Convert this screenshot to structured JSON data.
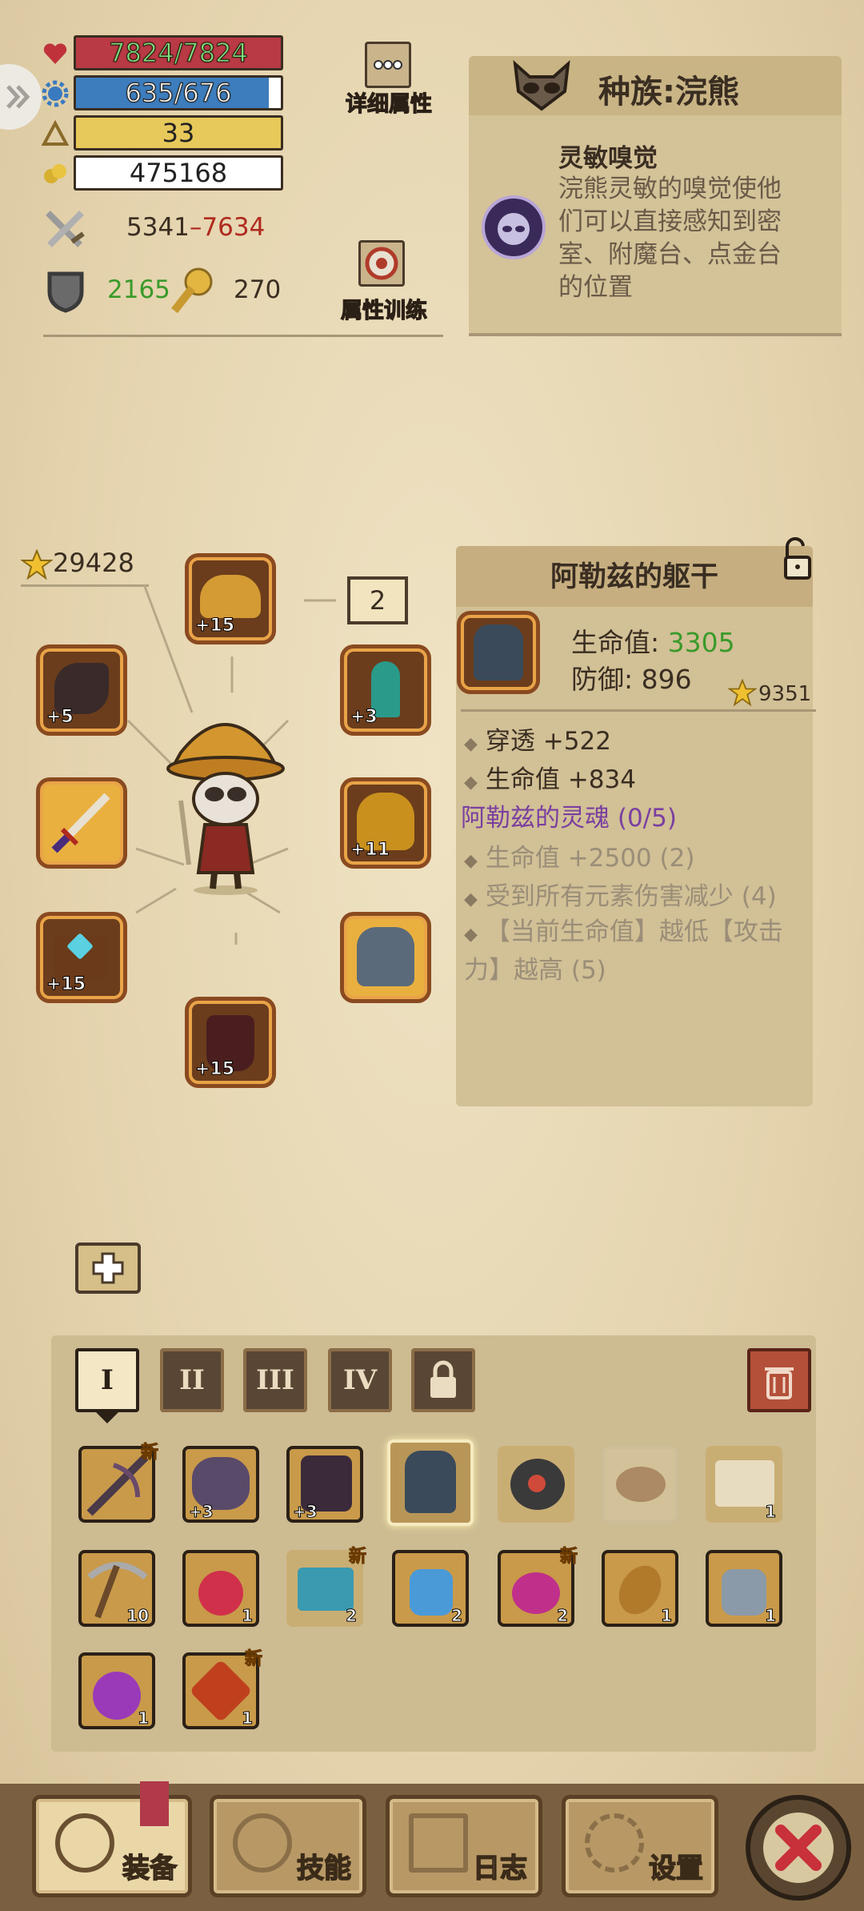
{
  "stats": {
    "hp": "7824/7824",
    "mp": "635/676",
    "level": "33",
    "gold": "475168",
    "attack_min": "5341",
    "attack_sep": "–",
    "attack_max": "7634",
    "defense": "2165",
    "tokens": "270"
  },
  "buttons": {
    "detail_attrs": "详细属性",
    "attr_training": "属性训练"
  },
  "race": {
    "title": "种族:浣熊",
    "trait_name": "灵敏嗅觉",
    "trait_desc": "浣熊灵敏的嗅觉使他们可以直接感知到密室、附魔台、点金台的位置"
  },
  "equipment": {
    "power": "29428",
    "page": "2",
    "levels": [
      "+15",
      "+5",
      "+3",
      "+11",
      "+15",
      "+15"
    ]
  },
  "item": {
    "name": "阿勒兹的躯干",
    "hp_label": "生命值: ",
    "hp_value": "3305",
    "def_label": "防御: 896",
    "score": "9351",
    "bonus1": "穿透 +522",
    "bonus2": "生命值 +834",
    "set_name": "阿勒兹的灵魂 (0/5)",
    "set1": "生命值 +2500 (2)",
    "set2": "受到所有元素伤害减少 (4)",
    "set3": "【当前生命值】越低【攻击力】越高 (5)"
  },
  "tabs": [
    "I",
    "II",
    "III",
    "IV"
  ],
  "inventory": {
    "new_label": "新",
    "counts": {
      "r1_2": "+3",
      "r1_3": "+3",
      "r1_7": "1",
      "r2_1": "10",
      "r2_2": "1",
      "r2_3": "2",
      "r2_4": "2",
      "r2_5": "2",
      "r2_6": "1",
      "r2_7": "1",
      "r3_1": "1",
      "r3_2": "1"
    }
  },
  "nav": {
    "equip": "装备",
    "skills": "技能",
    "log": "日志",
    "settings": "设置"
  },
  "colors": {
    "hp": "#b93a44",
    "mp": "#3d7dbd",
    "xp": "#e7c85a",
    "green": "#3a9a2a",
    "red": "#b02a1e",
    "purple": "#7a3fa0"
  }
}
